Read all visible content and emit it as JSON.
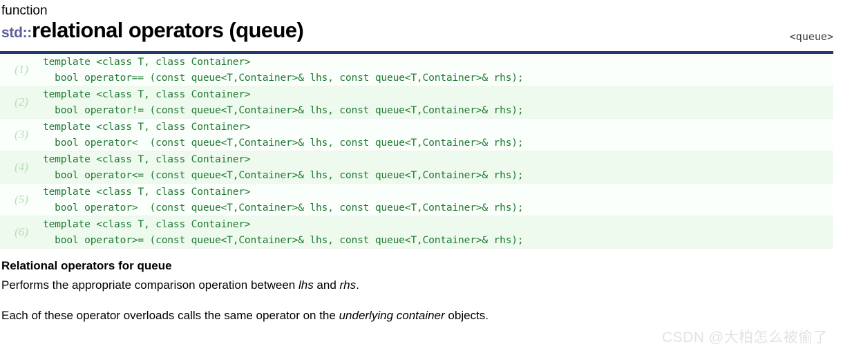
{
  "header": {
    "kind": "function",
    "namespace": "std::",
    "title": "relational operators (queue)",
    "include": "<queue>",
    "rule_color": "#24386b",
    "namespace_color": "#5c5c99"
  },
  "prototypes": [
    {
      "number": "(1)",
      "code": "template <class T, class Container>\n  bool operator== (const queue<T,Container>& lhs, const queue<T,Container>& rhs);"
    },
    {
      "number": "(2)",
      "code": "template <class T, class Container>\n  bool operator!= (const queue<T,Container>& lhs, const queue<T,Container>& rhs);"
    },
    {
      "number": "(3)",
      "code": "template <class T, class Container>\n  bool operator<  (const queue<T,Container>& lhs, const queue<T,Container>& rhs);"
    },
    {
      "number": "(4)",
      "code": "template <class T, class Container>\n  bool operator<= (const queue<T,Container>& lhs, const queue<T,Container>& rhs);"
    },
    {
      "number": "(5)",
      "code": "template <class T, class Container>\n  bool operator>  (const queue<T,Container>& lhs, const queue<T,Container>& rhs);"
    },
    {
      "number": "(6)",
      "code": "template <class T, class Container>\n  bool operator>= (const queue<T,Container>& lhs, const queue<T,Container>& rhs);"
    }
  ],
  "body": {
    "heading": "Relational operators for queue",
    "para1_before": "Performs the appropriate comparison operation between ",
    "para1_em1": "lhs",
    "para1_mid": " and ",
    "para1_em2": "rhs",
    "para1_after": ".",
    "para2_before": "Each of these operator overloads calls the same operator on the ",
    "para2_em": "underlying container",
    "para2_after": " objects."
  },
  "watermark": {
    "text": "CSDN @大柏怎么被偷了",
    "color": "#e3e3e3"
  },
  "code_colors": {
    "text": "#1f7a33",
    "number": "#b9dcb9",
    "row_odd": "#fbfffb",
    "row_even": "#edfaed"
  }
}
